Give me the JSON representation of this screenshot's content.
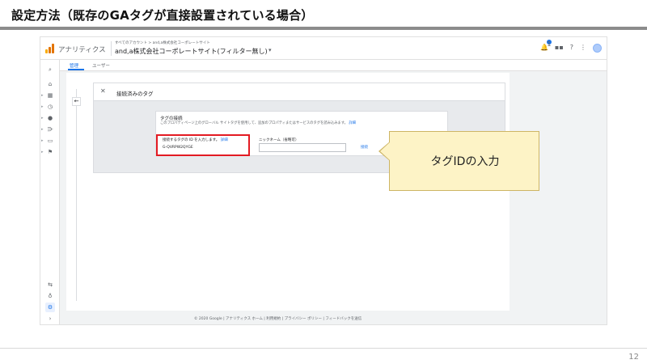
{
  "slide": {
    "title": "設定方法（既存のGAタグが直接設置されている場合）",
    "page_number": "12"
  },
  "app": {
    "product_name": "アナリティクス",
    "account_path": "すべてのアカウント > and,a株式会社コーポレートサイト",
    "property_name": "and,a株式会社コーポレートサイト(フィルター無し)",
    "notification_count": "1",
    "logo_colors": [
      "#f9ab00",
      "#e37400",
      "#e37400"
    ]
  },
  "tabs": [
    {
      "label": "管理",
      "active": true
    },
    {
      "label": "ユーザー",
      "active": false
    }
  ],
  "nav_icons": [
    "search-icon",
    "home-icon",
    "customization-icon",
    "clock-icon",
    "person-icon",
    "acquisition-icon",
    "behavior-icon",
    "flag-icon",
    "attribution-icon",
    "lightbulb-icon",
    "gear-icon",
    "expand-icon"
  ],
  "panel": {
    "title": "接続済みのタグ",
    "card": {
      "title": "タグの接続",
      "description": "このプロパティページ上のグローバル サイトタグを使用して、追加のプロパティまたはサービスのタグを読み込みます。",
      "detail_link": "詳細",
      "tag_id_label": "接続するタグの ID を入力します。",
      "tag_id_link": "詳細",
      "tag_id_value": "G-QVRPW2QYGE",
      "nickname_label": "ニックネーム（省略可）",
      "connect_button": "接続"
    }
  },
  "footer": "© 2020 Google | アナリティクス ホーム | 利用規約 | プライバシー ポリシー | フィードバックを送信",
  "callout": {
    "text": "タグIDの入力"
  },
  "colors": {
    "accent": "#1a73e8",
    "highlight": "#e31b23",
    "callout_fill": "#fdf3c6",
    "callout_border": "#cdb565"
  }
}
